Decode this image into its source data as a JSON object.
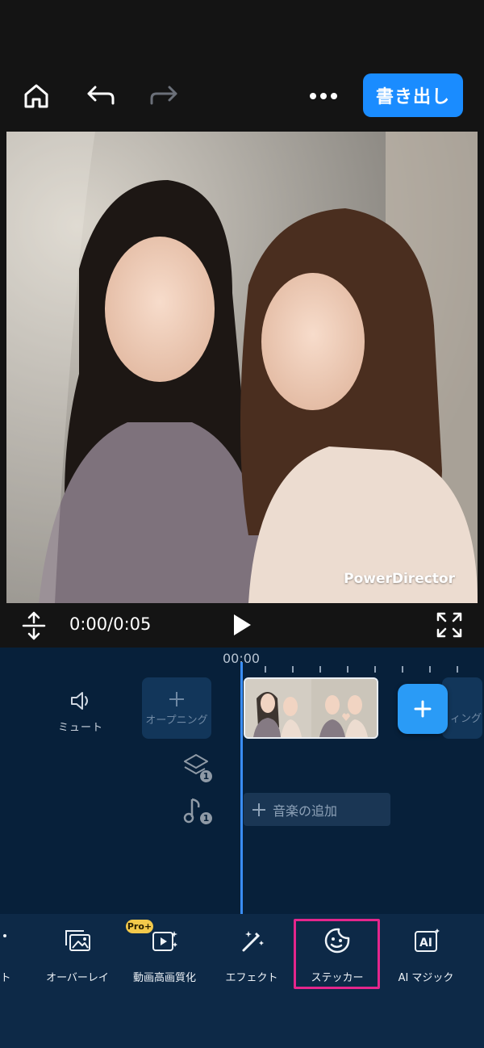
{
  "header": {
    "export_label": "書き出し"
  },
  "preview": {
    "watermark": "PowerDirector"
  },
  "playback": {
    "time": "0:00/0:05"
  },
  "timeline": {
    "ruler_label": "00:00",
    "mute_label": "ミュート",
    "opening_label": "オープニング",
    "ending_label": "ィング",
    "layer_count": "1",
    "music_count": "1",
    "add_music_label": "音楽の追加"
  },
  "toolbar": {
    "partial_label": "ト",
    "items": [
      {
        "label": "オーバーレイ",
        "icon": "overlay-icon"
      },
      {
        "label": "動画高画質化",
        "icon": "video-enhance-icon",
        "badge": "Pro+"
      },
      {
        "label": "エフェクト",
        "icon": "effect-wand-icon"
      },
      {
        "label": "ステッカー",
        "icon": "sticker-icon",
        "highlighted": true
      },
      {
        "label": "AI マジック",
        "icon": "ai-magic-icon"
      }
    ]
  },
  "colors": {
    "accent": "#1a8cff",
    "highlight": "#e4268c",
    "timeline_bg": "#07203a",
    "toolbar_bg": "#0d2947"
  }
}
